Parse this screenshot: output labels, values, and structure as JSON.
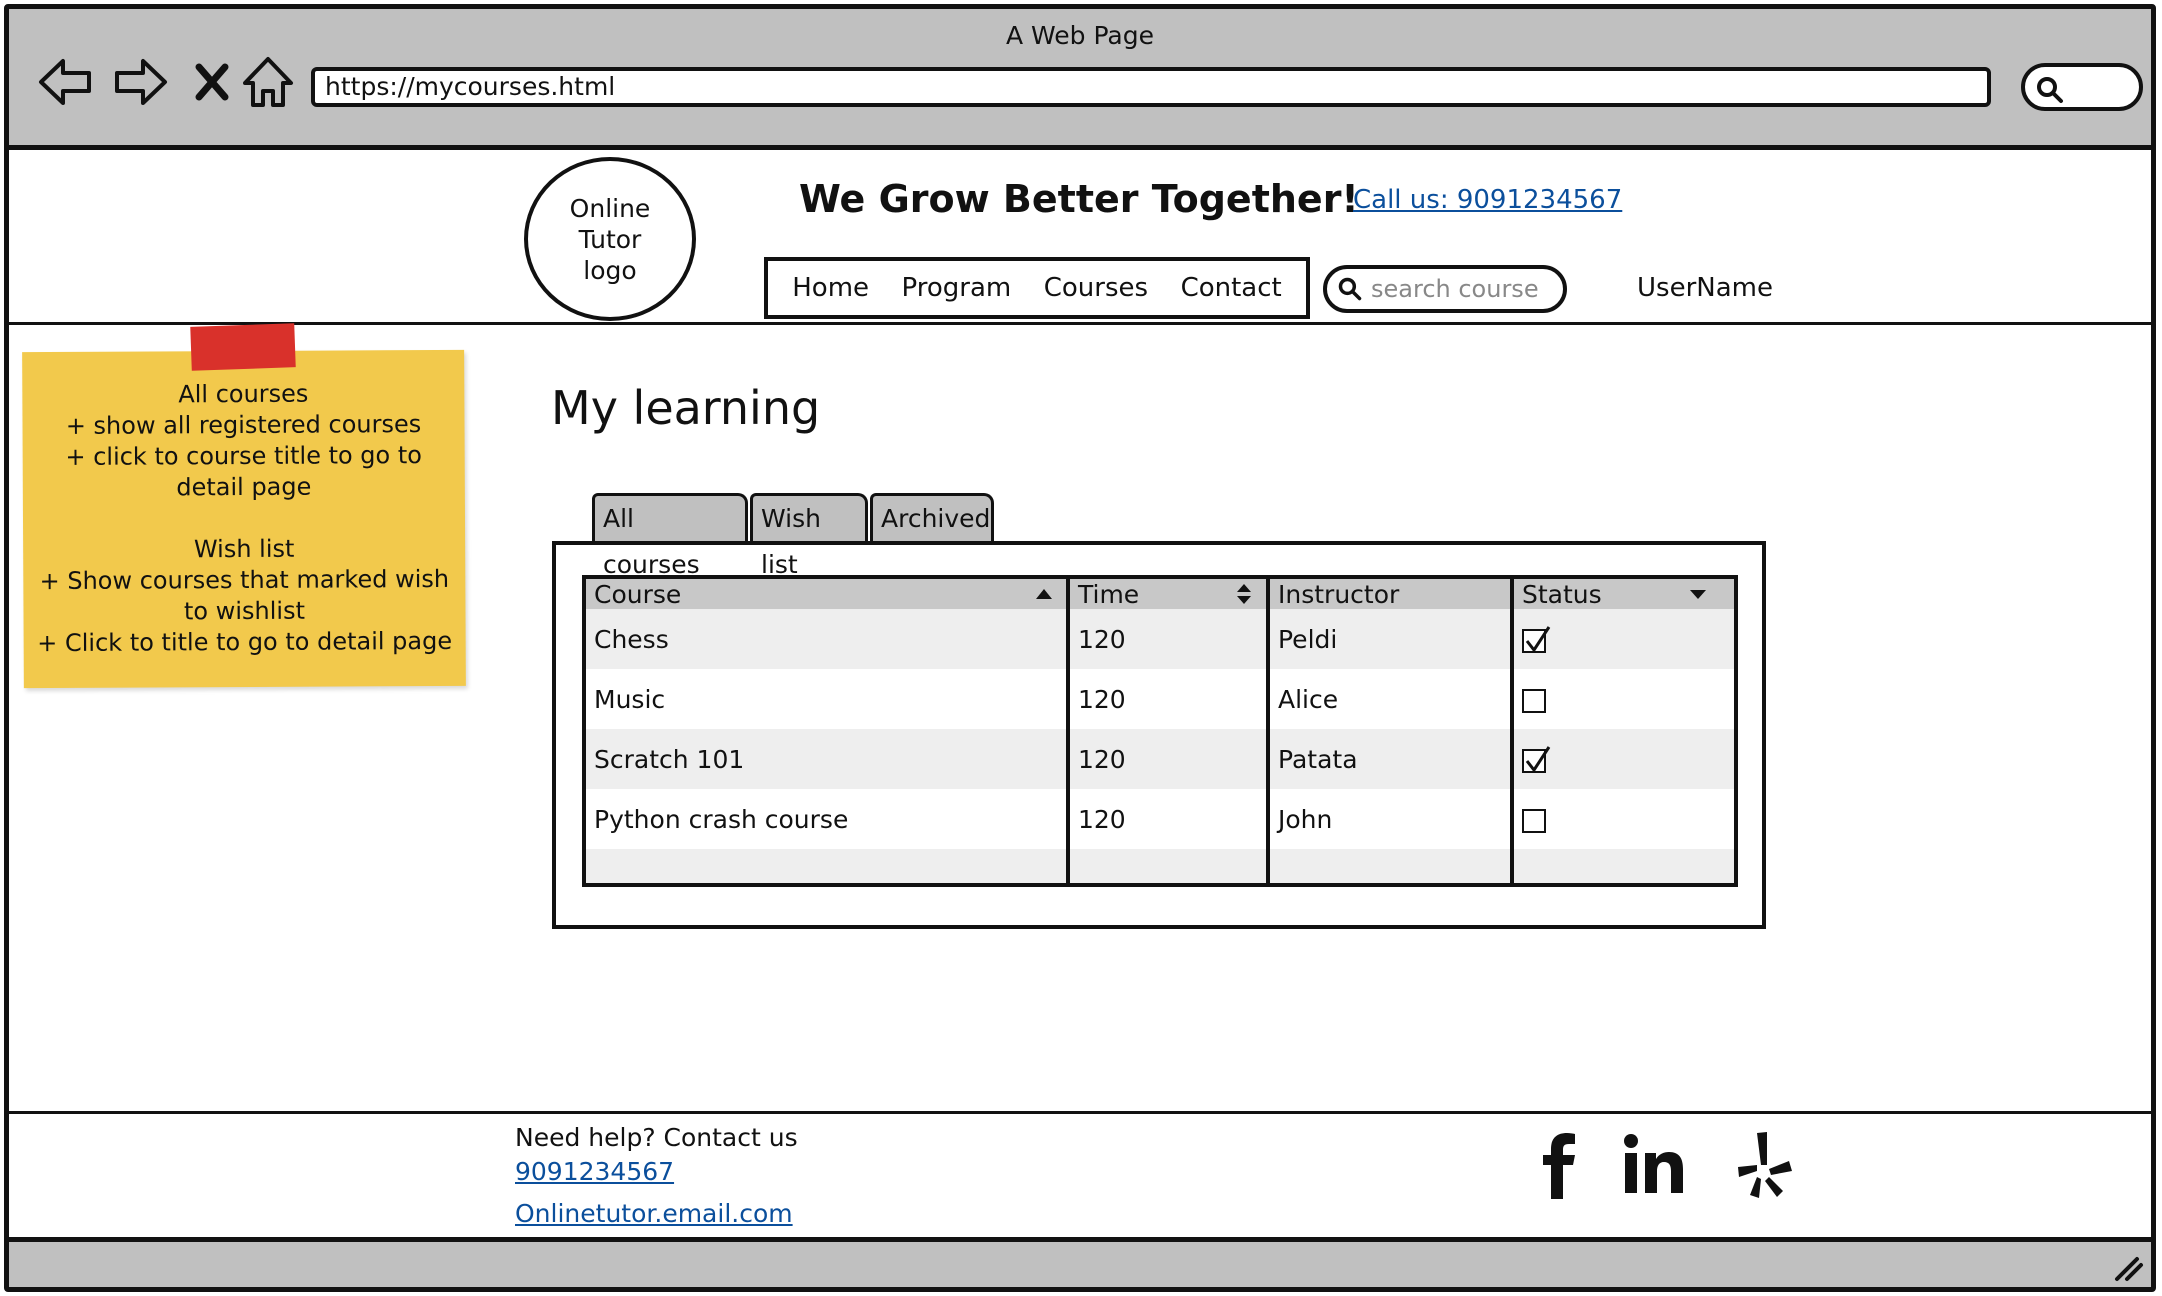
{
  "window": {
    "title": "A Web Page",
    "url": "https://mycourses.html"
  },
  "header": {
    "logo_lines": [
      "Online",
      "Tutor",
      "logo"
    ],
    "slogan": "We Grow Better Together!",
    "call_us": "Call us: 9091234567",
    "nav": [
      "Home",
      "Program",
      "Courses",
      "Contact"
    ],
    "search_placeholder": "search course",
    "username": "UserName"
  },
  "sticky_note": {
    "paragraphs": [
      "All courses\n+ show all registered courses\n+ click to course title to go to detail page",
      "Wish list\n+ Show courses that marked wish to wishlist\n+ Click to title to go to detail page"
    ],
    "lines_a": [
      "All courses",
      "+ show all registered courses",
      "+ click to course title to go to",
      "detail page"
    ],
    "lines_b": [
      "Wish list",
      "+ Show courses that marked wish",
      "to wishlist",
      "+ Click to title to go to detail page"
    ]
  },
  "main": {
    "title": "My learning",
    "tabs": [
      "All courses",
      "Wish list",
      "Archived"
    ],
    "table": {
      "columns": [
        "Course",
        "Time",
        "Instructor",
        "Status"
      ],
      "rows": [
        {
          "course": "Chess",
          "time": "120",
          "instructor": "Peldi",
          "status": true
        },
        {
          "course": "Music",
          "time": "120",
          "instructor": "Alice",
          "status": false
        },
        {
          "course": "Scratch 101",
          "time": "120",
          "instructor": "Patata",
          "status": true
        },
        {
          "course": "Python crash course",
          "time": "120",
          "instructor": "John",
          "status": false
        }
      ]
    }
  },
  "footer": {
    "help": "Need help? Contact us",
    "phone": "9091234567",
    "email": "Onlinetutor.email.com",
    "social_icons": [
      "facebook-icon",
      "linkedin-icon",
      "yelp-icon"
    ]
  },
  "colors": {
    "chrome": "#c0c0c0",
    "link": "#0b4f9c",
    "sticky": "#f2c94c",
    "tape": "#d9312b"
  }
}
